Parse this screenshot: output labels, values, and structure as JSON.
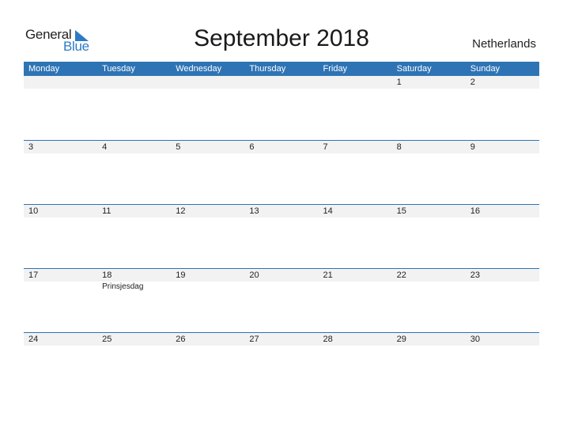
{
  "logo": {
    "text_general": "General",
    "text_blue": "Blue",
    "icon": "triangle-flag-icon"
  },
  "title": "September 2018",
  "country": "Netherlands",
  "colors": {
    "accent": "#2e74b5",
    "row_band": "#f2f2f2",
    "logo_blue": "#2e7ac4"
  },
  "weekdays": [
    "Monday",
    "Tuesday",
    "Wednesday",
    "Thursday",
    "Friday",
    "Saturday",
    "Sunday"
  ],
  "weeks": [
    {
      "days": [
        "",
        "",
        "",
        "",
        "",
        "1",
        "2"
      ],
      "events": [
        "",
        "",
        "",
        "",
        "",
        "",
        ""
      ]
    },
    {
      "days": [
        "3",
        "4",
        "5",
        "6",
        "7",
        "8",
        "9"
      ],
      "events": [
        "",
        "",
        "",
        "",
        "",
        "",
        ""
      ]
    },
    {
      "days": [
        "10",
        "11",
        "12",
        "13",
        "14",
        "15",
        "16"
      ],
      "events": [
        "",
        "",
        "",
        "",
        "",
        "",
        ""
      ]
    },
    {
      "days": [
        "17",
        "18",
        "19",
        "20",
        "21",
        "22",
        "23"
      ],
      "events": [
        "",
        "Prinsjesdag",
        "",
        "",
        "",
        "",
        ""
      ]
    },
    {
      "days": [
        "24",
        "25",
        "26",
        "27",
        "28",
        "29",
        "30"
      ],
      "events": [
        "",
        "",
        "",
        "",
        "",
        "",
        ""
      ]
    }
  ]
}
